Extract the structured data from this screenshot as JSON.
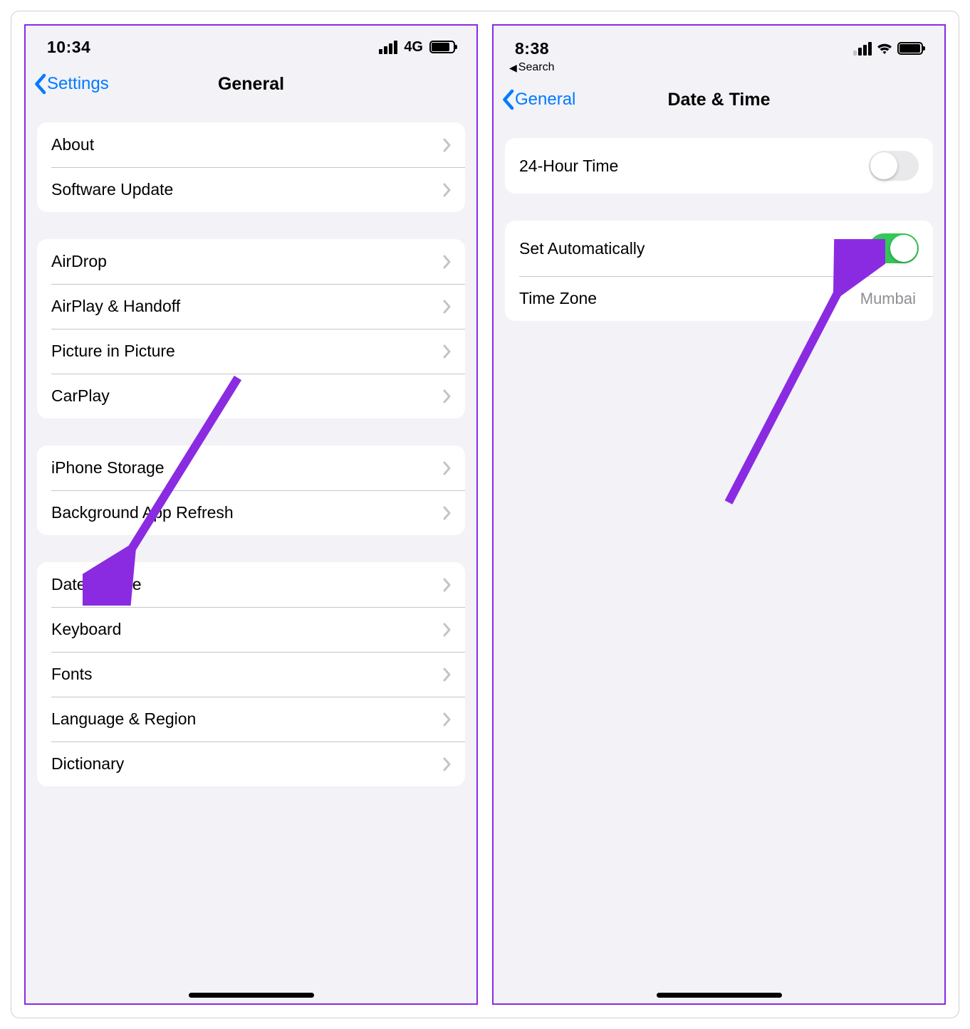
{
  "colors": {
    "accent_blue": "#007aff",
    "annotation_purple": "#8a2be2",
    "switch_green": "#34c759"
  },
  "left": {
    "status": {
      "time": "10:34",
      "network_label": "4G",
      "battery_pct": 78
    },
    "nav": {
      "back_label": "Settings",
      "title": "General"
    },
    "groups": [
      {
        "rows": [
          {
            "label": "About"
          },
          {
            "label": "Software Update"
          }
        ]
      },
      {
        "rows": [
          {
            "label": "AirDrop"
          },
          {
            "label": "AirPlay & Handoff"
          },
          {
            "label": "Picture in Picture"
          },
          {
            "label": "CarPlay"
          }
        ]
      },
      {
        "rows": [
          {
            "label": "iPhone Storage"
          },
          {
            "label": "Background App Refresh"
          }
        ]
      },
      {
        "rows": [
          {
            "label": "Date & Time"
          },
          {
            "label": "Keyboard"
          },
          {
            "label": "Fonts"
          },
          {
            "label": "Language & Region"
          },
          {
            "label": "Dictionary"
          }
        ]
      }
    ],
    "annotation": {
      "target": "Date & Time"
    }
  },
  "right": {
    "status": {
      "time": "8:38",
      "back_to": "Search",
      "battery_pct": 92
    },
    "nav": {
      "back_label": "General",
      "title": "Date & Time"
    },
    "groups": [
      {
        "rows": [
          {
            "label": "24-Hour Time",
            "switch": false
          }
        ]
      },
      {
        "rows": [
          {
            "label": "Set Automatically",
            "switch": true
          },
          {
            "label": "Time Zone",
            "value": "Mumbai"
          }
        ]
      }
    ],
    "annotation": {
      "target": "Set Automatically"
    }
  }
}
